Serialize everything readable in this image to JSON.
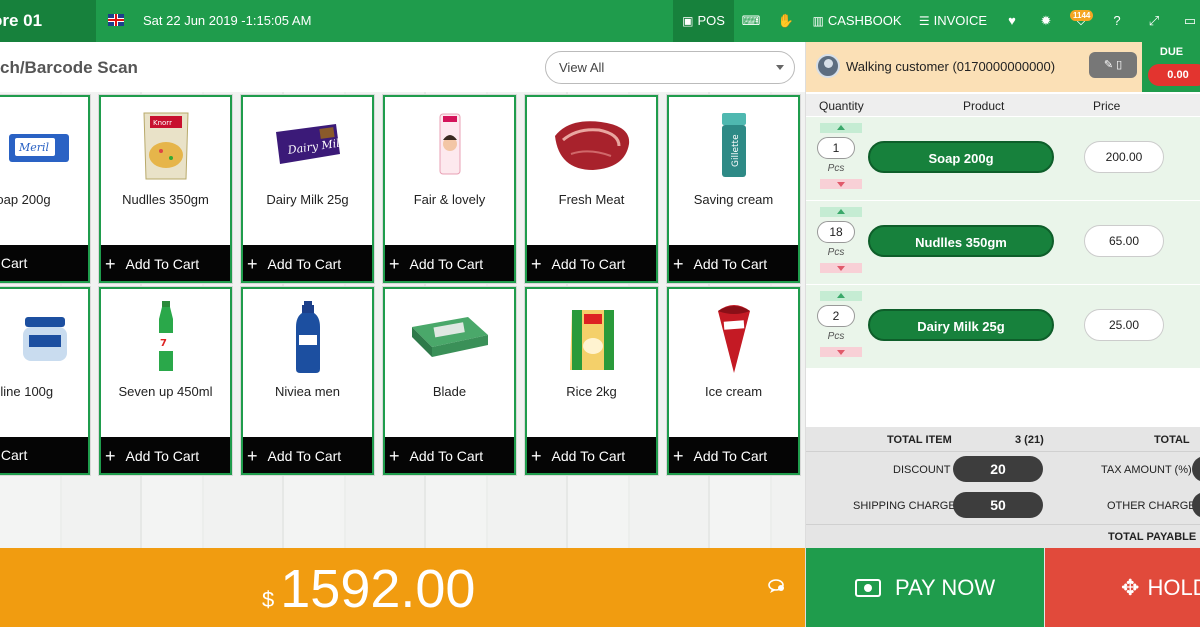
{
  "topbar": {
    "store_name": "ore 01",
    "datetime": "Sat 22 Jun 2019 -1:15:05 AM",
    "pos_label": "POS",
    "cashbook_label": "CASHBOOK",
    "invoice_label": "INVOICE",
    "notification_count": "1144"
  },
  "search": {
    "text": "ch/Barcode Scan",
    "filter_value": "View All"
  },
  "products": [
    {
      "name": "oap 200g",
      "add_label": "dd To Cart"
    },
    {
      "name": "Nudlles 350gm",
      "add_label": "Add To Cart"
    },
    {
      "name": "Dairy Milk 25g",
      "add_label": "Add To Cart"
    },
    {
      "name": "Fair & lovely",
      "add_label": "Add To Cart"
    },
    {
      "name": "Fresh Meat",
      "add_label": "Add To Cart"
    },
    {
      "name": "Saving cream",
      "add_label": "Add To Cart"
    },
    {
      "name": "sline 100g",
      "add_label": "dd To Cart"
    },
    {
      "name": "Seven up 450ml",
      "add_label": "Add To Cart"
    },
    {
      "name": "Niviea men",
      "add_label": "Add To Cart"
    },
    {
      "name": "Blade",
      "add_label": "Add To Cart"
    },
    {
      "name": "Rice 2kg",
      "add_label": "Add To Cart"
    },
    {
      "name": "Ice cream",
      "add_label": "Add To Cart"
    }
  ],
  "total": {
    "currency": "$",
    "amount": "1592.00"
  },
  "customer": {
    "name": "Walking customer (0170000000000)",
    "due_label": "DUE",
    "due_value": "0.00"
  },
  "cart": {
    "headers": [
      "Quantity",
      "Product",
      "Price"
    ],
    "unit": "Pcs",
    "items": [
      {
        "qty": "1",
        "product": "Soap 200g",
        "price": "200.00"
      },
      {
        "qty": "18",
        "product": "Nudlles 350gm",
        "price": "65.00"
      },
      {
        "qty": "2",
        "product": "Dairy Milk 25g",
        "price": "25.00"
      }
    ]
  },
  "summary": {
    "total_item_label": "TOTAL ITEM",
    "total_item_value": "3 (21)",
    "total_label": "TOTAL",
    "discount_label": "DISCOUNT",
    "discount_value": "20",
    "tax_label": "TAX AMOUNT (%)",
    "shipping_label": "SHIPPING CHARGE",
    "shipping_value": "50",
    "other_label": "OTHER CHARGE",
    "payable_label": "TOTAL PAYABLE"
  },
  "actions": {
    "pay_now": "PAY NOW",
    "hold": "HOLD"
  },
  "colors": {
    "brand_green": "#1f9c4c",
    "total_orange": "#f19c10",
    "hold_red": "#e14a3b"
  }
}
